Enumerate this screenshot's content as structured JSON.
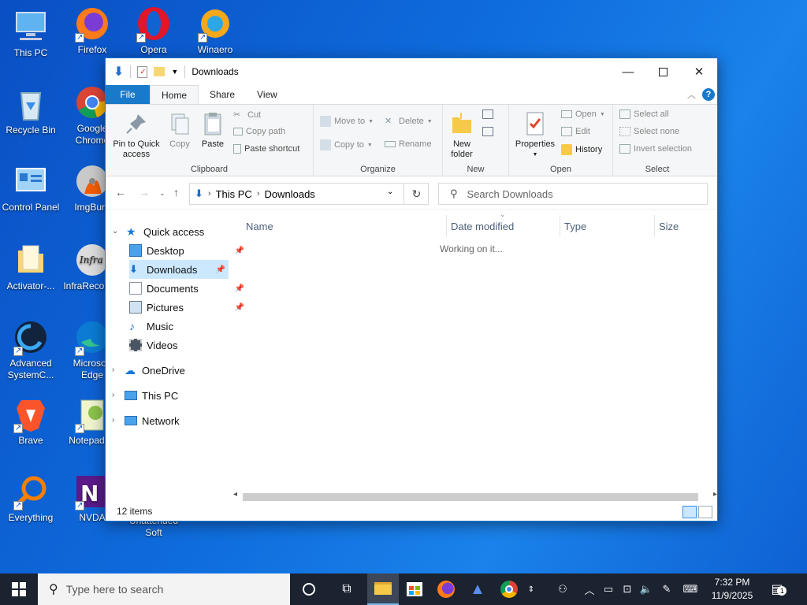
{
  "desktop": {
    "icons": [
      {
        "label": "This PC"
      },
      {
        "label": "Firefox"
      },
      {
        "label": "Opera"
      },
      {
        "label": "Winaero"
      },
      {
        "label": "Recycle Bin"
      },
      {
        "label": "Google Chrome"
      },
      {
        "label": "Control Panel"
      },
      {
        "label": "ImgBurn"
      },
      {
        "label": "Activator-..."
      },
      {
        "label": "InfraRecorder"
      },
      {
        "label": "Advanced SystemC..."
      },
      {
        "label": "Microsoft Edge"
      },
      {
        "label": "Brave"
      },
      {
        "label": "Notepad++"
      },
      {
        "label": "Everything"
      },
      {
        "label": "NVDA"
      },
      {
        "label": "Unattended Soft"
      }
    ]
  },
  "explorer": {
    "title": "Downloads",
    "tabs": {
      "file": "File",
      "home": "Home",
      "share": "Share",
      "view": "View"
    },
    "ribbon": {
      "clipboard": {
        "label": "Clipboard",
        "pin": "Pin to Quick access",
        "copy": "Copy",
        "paste": "Paste",
        "cut": "Cut",
        "copy_path": "Copy path",
        "paste_shortcut": "Paste shortcut"
      },
      "organize": {
        "label": "Organize",
        "move_to": "Move to",
        "copy_to": "Copy to",
        "delete": "Delete",
        "rename": "Rename"
      },
      "new": {
        "label": "New",
        "new_folder": "New folder"
      },
      "open": {
        "label": "Open",
        "properties": "Properties",
        "open": "Open",
        "edit": "Edit",
        "history": "History"
      },
      "select": {
        "label": "Select",
        "select_all": "Select all",
        "select_none": "Select none",
        "invert": "Invert selection"
      }
    },
    "address": {
      "crumbs": [
        "This PC",
        "Downloads"
      ],
      "search_placeholder": "Search Downloads"
    },
    "nav": {
      "quick_access": "Quick access",
      "items": [
        "Desktop",
        "Downloads",
        "Documents",
        "Pictures",
        "Music",
        "Videos"
      ],
      "onedrive": "OneDrive",
      "this_pc": "This PC",
      "network": "Network"
    },
    "columns": [
      "Name",
      "Date modified",
      "Type",
      "Size"
    ],
    "status_message": "Working on it...",
    "item_count": "12 items"
  },
  "taskbar": {
    "search_placeholder": "Type here to search",
    "time": "7:32 PM",
    "date": "11/9/2025",
    "notification_count": "1"
  },
  "colors": {
    "desktop_bg": "#0f6ddd",
    "accent": "#1979ca",
    "selected": "#cce8ff",
    "taskbar": "#1b2230"
  }
}
